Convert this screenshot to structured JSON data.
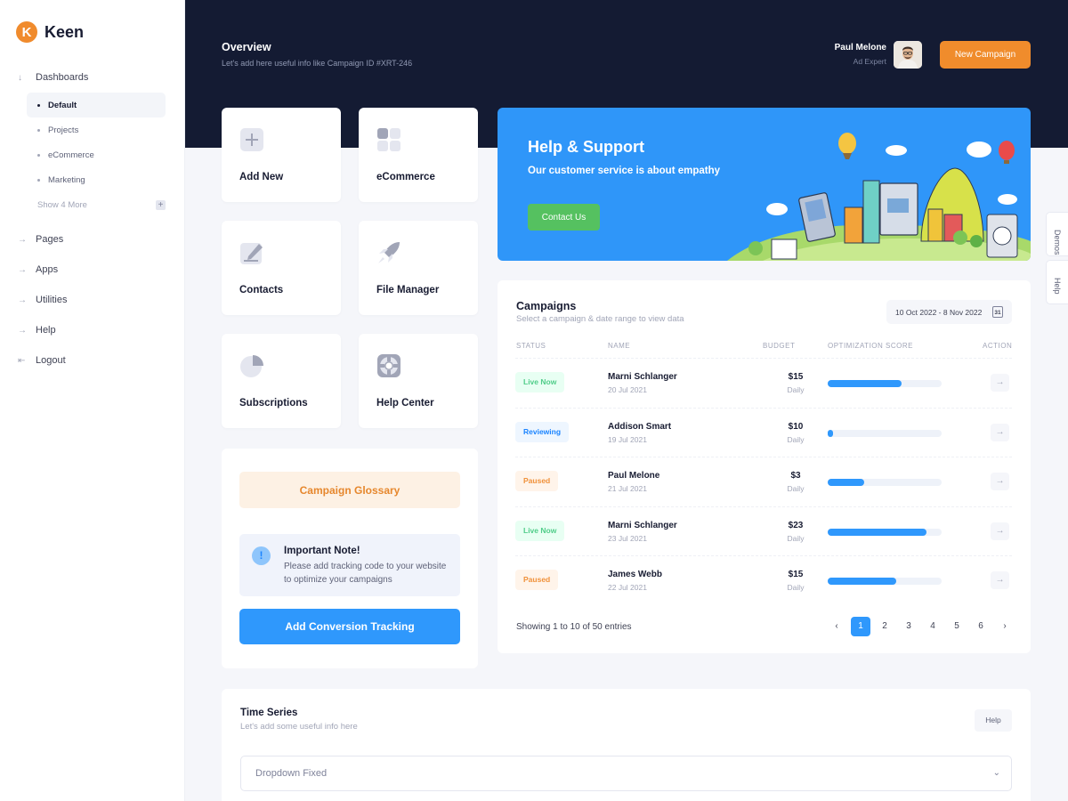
{
  "brand": {
    "logo_letter": "K",
    "name": "Keen",
    "color": "#f08b2d"
  },
  "sidebar": {
    "items": [
      {
        "label": "Dashboards",
        "arrow": "↓"
      },
      {
        "label": "Pages",
        "arrow": "→"
      },
      {
        "label": "Apps",
        "arrow": "→"
      },
      {
        "label": "Utilities",
        "arrow": "→"
      },
      {
        "label": "Help",
        "arrow": "→"
      },
      {
        "label": "Logout",
        "arrow": "⇤"
      }
    ],
    "dashboards_sub": [
      "Default",
      "Projects",
      "eCommerce",
      "Marketing"
    ],
    "show_more": "Show 4 More",
    "show_more_icon": "+"
  },
  "header": {
    "title": "Overview",
    "subtitle": "Let's add here useful info like Campaign ID #XRT-246",
    "user_name": "Paul Melone",
    "user_role": "Ad Expert",
    "new_campaign": "New Campaign"
  },
  "tiles": [
    {
      "label": "Add New",
      "icon": "plus-icon"
    },
    {
      "label": "eCommerce",
      "icon": "grid-icon"
    },
    {
      "label": "Contacts",
      "icon": "edit-icon"
    },
    {
      "label": "File Manager",
      "icon": "rocket-icon"
    },
    {
      "label": "Subscriptions",
      "icon": "pie-chart-icon"
    },
    {
      "label": "Help Center",
      "icon": "lifebuoy-icon"
    }
  ],
  "glossary": {
    "button": "Campaign Glossary",
    "note_icon": "!",
    "note_title": "Important Note!",
    "note_text": "Please add tracking code to your website to optimize your campaigns",
    "conversion_button": "Add Conversion Tracking"
  },
  "help_banner": {
    "title": "Help & Support",
    "subtitle": "Our customer service is about empathy",
    "contact_button": "Contact Us"
  },
  "campaigns": {
    "title": "Campaigns",
    "subtitle": "Select a campaign & date range to view data",
    "date_range": "10 Oct 2022 - 8 Nov 2022",
    "calendar_day": "31",
    "columns": [
      "STATUS",
      "NAME",
      "BUDGET",
      "OPTIMIZATION SCORE",
      "ACTION"
    ],
    "rows": [
      {
        "status": "Live Now",
        "status_kind": "live",
        "name": "Marni Schlanger",
        "date": "20 Jul 2021",
        "budget": "$15",
        "period": "Daily",
        "score": 0.65
      },
      {
        "status": "Reviewing",
        "status_kind": "review",
        "name": "Addison Smart",
        "date": "19 Jul 2021",
        "budget": "$10",
        "period": "Daily",
        "score": 0.05
      },
      {
        "status": "Paused",
        "status_kind": "paused",
        "name": "Paul Melone",
        "date": "21 Jul 2021",
        "budget": "$3",
        "period": "Daily",
        "score": 0.32
      },
      {
        "status": "Live Now",
        "status_kind": "live",
        "name": "Marni Schlanger",
        "date": "23 Jul 2021",
        "budget": "$23",
        "period": "Daily",
        "score": 0.87
      },
      {
        "status": "Paused",
        "status_kind": "paused",
        "name": "James Webb",
        "date": "22 Jul 2021",
        "budget": "$15",
        "period": "Daily",
        "score": 0.6
      }
    ],
    "action_icon": "→",
    "showing": "Showing 1 to 10 of 50 entries",
    "pages": [
      "1",
      "2",
      "3",
      "4",
      "5",
      "6"
    ],
    "active_page": "1",
    "prev": "‹",
    "next": "›"
  },
  "timeseries": {
    "title": "Time Series",
    "subtitle": "Let's add some useful info here",
    "help": "Help",
    "dropdown_placeholder": "Dropdown Fixed",
    "chevron": "⌄"
  },
  "side_tabs": [
    "Demos",
    "Help"
  ]
}
